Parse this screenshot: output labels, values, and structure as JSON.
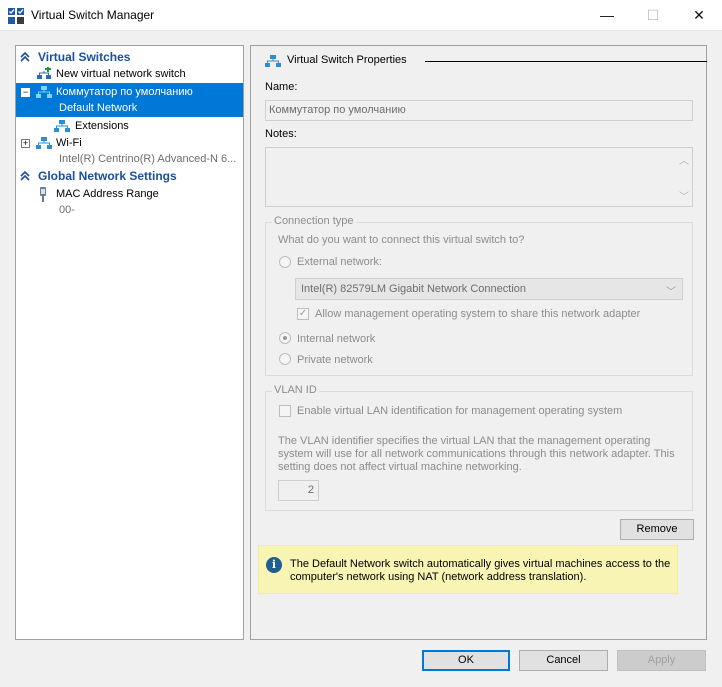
{
  "window": {
    "title": "Virtual Switch Manager",
    "min_glyph": "—",
    "max_glyph": "☐",
    "close_glyph": "✕"
  },
  "tree": {
    "virtual_switches_header": "Virtual Switches",
    "new_switch": "New virtual network switch",
    "default_switch_name": "Коммутатор по умолчанию",
    "default_switch_sub": "Default Network",
    "extensions": "Extensions",
    "wifi_name": "Wi-Fi",
    "wifi_sub": "Intel(R) Centrino(R) Advanced-N 6...",
    "global_header": "Global Network Settings",
    "mac_range": "MAC Address Range",
    "mac_sub": "00-",
    "expander_minus": "−",
    "expander_plus": "+"
  },
  "properties": {
    "section_title": "Virtual Switch Properties",
    "name_label": "Name:",
    "name_value": "Коммутатор по умолчанию",
    "notes_label": "Notes:",
    "notes_value": "",
    "connection_type": {
      "title": "Connection type",
      "question": "What do you want to connect this virtual switch to?",
      "external_label": "External network:",
      "adapter_value": "Intel(R) 82579LM Gigabit Network Connection",
      "allow_mgmt_label": "Allow management operating system to share this network adapter",
      "allow_mgmt_checked": true,
      "internal_label": "Internal network",
      "private_label": "Private network",
      "selected": "Internal network"
    },
    "vlan": {
      "title": "VLAN ID",
      "enable_label": "Enable virtual LAN identification for management operating system",
      "enable_checked": false,
      "description": "The VLAN identifier specifies the virtual LAN that the management operating system will use for all network communications through this network adapter. This setting does not affect virtual machine networking.",
      "id_value": "2"
    },
    "remove_button": "Remove",
    "info_text": "The Default Network switch automatically gives virtual machines access to the computer's network using NAT (network address translation)."
  },
  "buttons": {
    "ok": "OK",
    "cancel": "Cancel",
    "apply": "Apply"
  },
  "colors": {
    "selection": "#0078d7",
    "section_header": "#1a4f9e",
    "info_background": "#f7f4b4"
  },
  "icons": {
    "app": "virtual-switch-manager-icon",
    "switch": "network-switch-icon",
    "new_switch": "add-network-switch-icon",
    "mac": "mac-address-plug-icon",
    "info": "info-icon",
    "collapse": "double-chevron-up-icon"
  }
}
